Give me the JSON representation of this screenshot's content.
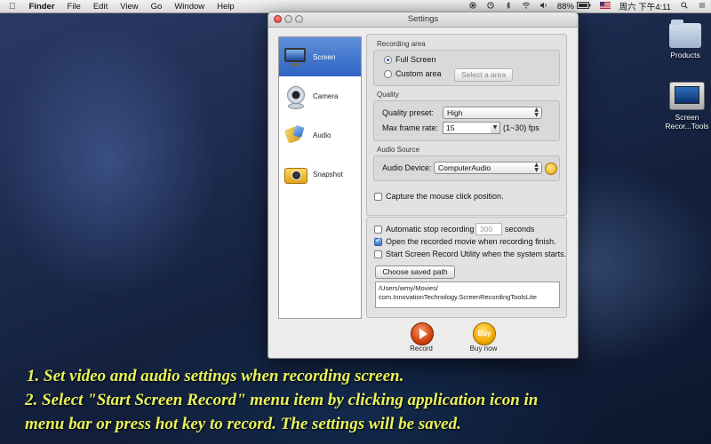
{
  "menubar": {
    "app_name": "Finder",
    "menus": [
      "File",
      "Edit",
      "View",
      "Go",
      "Window",
      "Help"
    ],
    "battery": "88%",
    "clock": "周六 下午4:11",
    "tray_icons": [
      "record-icon",
      "bluetooth-icon",
      "wifi-icon",
      "volume-icon",
      "battery-icon",
      "flag-icon",
      "user-icon",
      "spotlight-icon",
      "list-icon"
    ]
  },
  "desktop": {
    "icons": [
      {
        "label": "Products"
      },
      {
        "label": "Screen Recor...Tools"
      }
    ]
  },
  "window": {
    "title": "Settings",
    "sidebar": [
      {
        "label": "Screen",
        "icon": "monitor-icon",
        "selected": true
      },
      {
        "label": "Camera",
        "icon": "webcam-icon",
        "selected": false
      },
      {
        "label": "Audio",
        "icon": "audio-icon",
        "selected": false
      },
      {
        "label": "Snapshot",
        "icon": "snapshot-camera-icon",
        "selected": false
      }
    ],
    "recording_area": {
      "title": "Recording area",
      "full_screen": "Full Screen",
      "custom_area": "Custom area",
      "select_button": "Select a area",
      "selected": "full_screen"
    },
    "quality": {
      "title": "Quality",
      "preset_label": "Quality preset:",
      "preset_value": "High",
      "frame_label": "Max frame rate:",
      "frame_value": "15",
      "frame_hint": "(1~30) fps"
    },
    "audio_source": {
      "title": "Audio Source",
      "device_label": "Audio Device:",
      "device_value": "ComputerAudio"
    },
    "capture_mouse": {
      "label": "Capture the mouse click position.",
      "checked": false
    },
    "options": {
      "auto_stop_label": "Automatic stop recording",
      "auto_stop_value": "300",
      "auto_stop_unit": "seconds",
      "auto_stop_checked": false,
      "open_movie_label": "Open the recorded movie when recording finish.",
      "open_movie_checked": true,
      "start_util_label": "Start Screen Record Utility when the system starts.",
      "start_util_checked": false,
      "choose_path_button": "Choose saved path",
      "saved_path_line1": "/Users/wmy/Movies/",
      "saved_path_line2": "com.InnovationTechnology.ScreenRecordingToolsLite"
    },
    "actions": {
      "record_label": "Record",
      "buy_label": "Buy now",
      "buy_icon_text": "Buy"
    }
  },
  "caption": {
    "line1": "1. Set video and audio settings when recording screen.",
    "line2": "2. Select \"Start Screen Record\" menu item by clicking application icon in",
    "line3": "menu bar or press hot key to record. The settings will be saved."
  },
  "colors": {
    "caption_text": "#e8f25a",
    "selection_blue": "#2f64c5",
    "record_orange": "#d0400f",
    "buy_gold": "#f3a900"
  }
}
